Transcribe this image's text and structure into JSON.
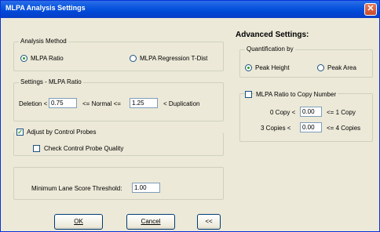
{
  "window": {
    "title": "MLPA Analysis Settings"
  },
  "analysis_method": {
    "legend": "Analysis Method",
    "ratio_label": "MLPA Ratio",
    "regression_label": "MLPA Regression T-Dist",
    "selected": "MLPA Ratio"
  },
  "settings_ratio": {
    "legend": "Settings - MLPA Ratio",
    "deletion_label": "Deletion <",
    "deletion_value": "0.75",
    "normal_label": "<= Normal <=",
    "normal_value": "1.25",
    "duplication_label": "< Duplication"
  },
  "control_probes": {
    "adjust_label": "Adjust by Control Probes",
    "adjust_checked": true,
    "quality_label": "Check Control Probe Quality",
    "quality_checked": false
  },
  "lane_score": {
    "label": "Minimum Lane Score Threshold:",
    "value": "1.00"
  },
  "buttons": {
    "ok": "OK",
    "cancel": "Cancel",
    "collapse": "<<"
  },
  "advanced": {
    "title": "Advanced Settings:",
    "quantification": {
      "legend": "Quantification by",
      "peak_height": "Peak Height",
      "peak_area": "Peak Area",
      "selected": "Peak Height"
    },
    "copy_number": {
      "label": "MLPA Ratio to Copy Number",
      "checked": false,
      "copy0_label": "0 Copy <",
      "copy0_value": "0.00",
      "copy1_label": "<= 1 Copy",
      "copy3_label": "3 Copies <",
      "copy3_value": "0.00",
      "copy4_label": "<= 4 Copies"
    }
  }
}
